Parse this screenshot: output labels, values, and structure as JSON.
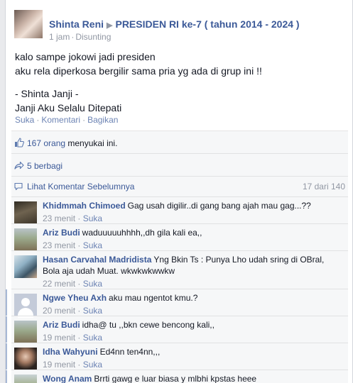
{
  "post": {
    "author": "Shinta Reni",
    "arrow": "▶",
    "group": "PRESIDEN RI ke-7 ( tahun 2014 - 2024 )",
    "time": "1 jam",
    "dot": "·",
    "status": "Disunting",
    "text_line1": "kalo sampe jokowi jadi presiden",
    "text_line2": "aku rela diperkosa bergilir sama pria yg ada di grup ini !!",
    "text_line3": "- Shinta Janji -",
    "text_line4": "Janji Aku Selalu Ditepati",
    "actions": {
      "like": "Suka",
      "comment": "Komentari",
      "share": "Bagikan"
    }
  },
  "likes": {
    "count": "167 orang",
    "text": " menyukai ini."
  },
  "shares": {
    "text": "5 berbagi"
  },
  "previous_comments": {
    "label": "Lihat Komentar Sebelumnya",
    "count": "17 dari 140"
  },
  "comments": [
    {
      "name": "Khidmmah Chimoed",
      "text": "Gag usah digilir..di gang bang ajah mau gag...??",
      "time": "23 menit",
      "like": "Suka",
      "avatar": "photo-dark"
    },
    {
      "name": "Ariz Budi",
      "text": "waduuuuuhhhh,,dh gila kali ea,,",
      "time": "23 menit",
      "like": "Suka",
      "avatar": "photo-outdoor"
    },
    {
      "name": "Hasan Carvahal Madridista",
      "text": "Yng Bkin Ts : Punya Lho udah sring di OBral, Bola aja udah Muat. wkwkwkwwkw",
      "time": "22 menit",
      "like": "Suka",
      "avatar": "photo-person"
    },
    {
      "name": "Ngwe Yheu Axh",
      "text": "aku mau ngentot kmu.?",
      "time": "20 menit",
      "like": "Suka",
      "avatar": "default-avatar"
    },
    {
      "name": "Ariz Budi",
      "text": "idha@ tu ,,bkn cewe bencong kali,,",
      "time": "19 menit",
      "like": "Suka",
      "avatar": "photo-outdoor"
    },
    {
      "name": "Idha Wahyuni",
      "text": "Ed4nn ten4nn,,,",
      "time": "19 menit",
      "like": "Suka",
      "avatar": "photo-woman"
    },
    {
      "name": "Wong Anam",
      "text": "Brrti gawg e luar biasa y mlbhi kpstas heee",
      "time": "",
      "like": "",
      "avatar": "photo-outdoor"
    }
  ],
  "colors": {
    "link": "#3b5998",
    "meta": "#9197a3",
    "ufi_bg": "#f6f7f8"
  }
}
